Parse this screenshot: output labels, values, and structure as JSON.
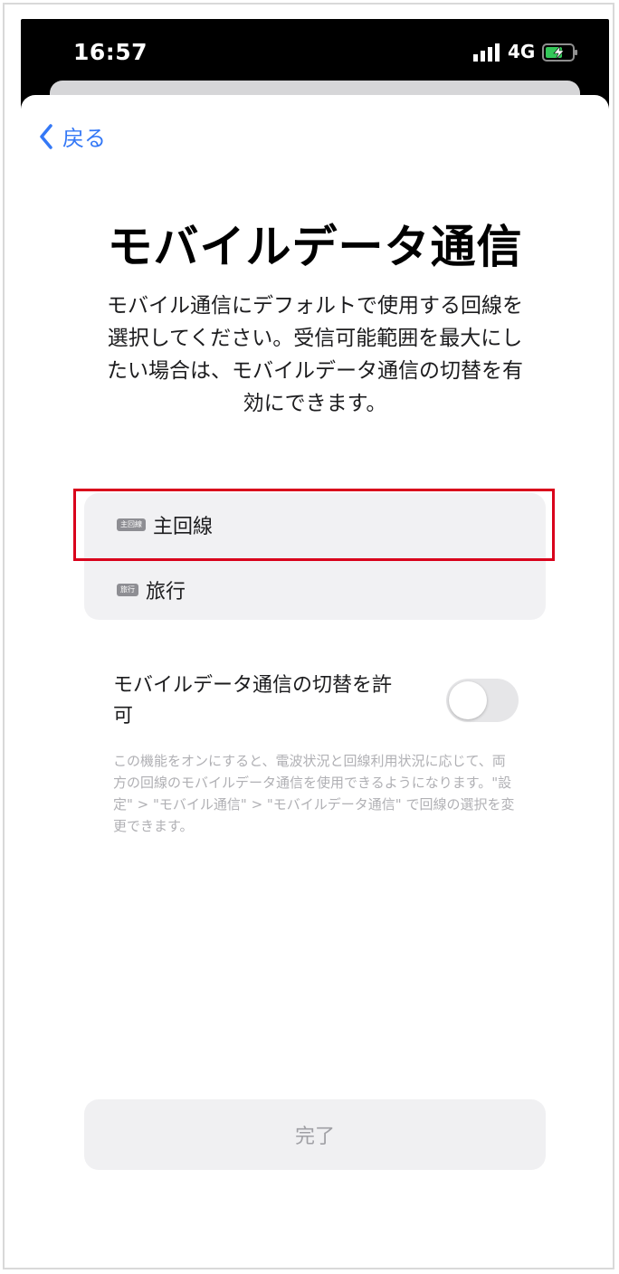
{
  "status_bar": {
    "time": "16:57",
    "network": "4G"
  },
  "nav": {
    "back_label": "戻る"
  },
  "page": {
    "title": "モバイルデータ通信",
    "description": "モバイル通信にデフォルトで使用する回線を選択してください。受信可能範囲を最大にしたい場合は、モバイルデータ通信の切替を有効にできます。"
  },
  "lines": [
    {
      "badge": "主回線",
      "label": "主回線",
      "highlighted": true
    },
    {
      "badge": "旅行",
      "label": "旅行",
      "highlighted": false
    }
  ],
  "switching": {
    "label": "モバイルデータ通信の切替を許可",
    "enabled": false,
    "note": "この機能をオンにすると、電波状況と回線利用状況に応じて、両方の回線のモバイルデータ通信を使用できるようになります。\"設定\" > \"モバイル通信\" > \"モバイルデータ通信\" で回線の選択を変更できます。"
  },
  "footer": {
    "done_label": "完了"
  },
  "colors": {
    "accent": "#3478f6",
    "highlight_border": "#d9001b"
  }
}
